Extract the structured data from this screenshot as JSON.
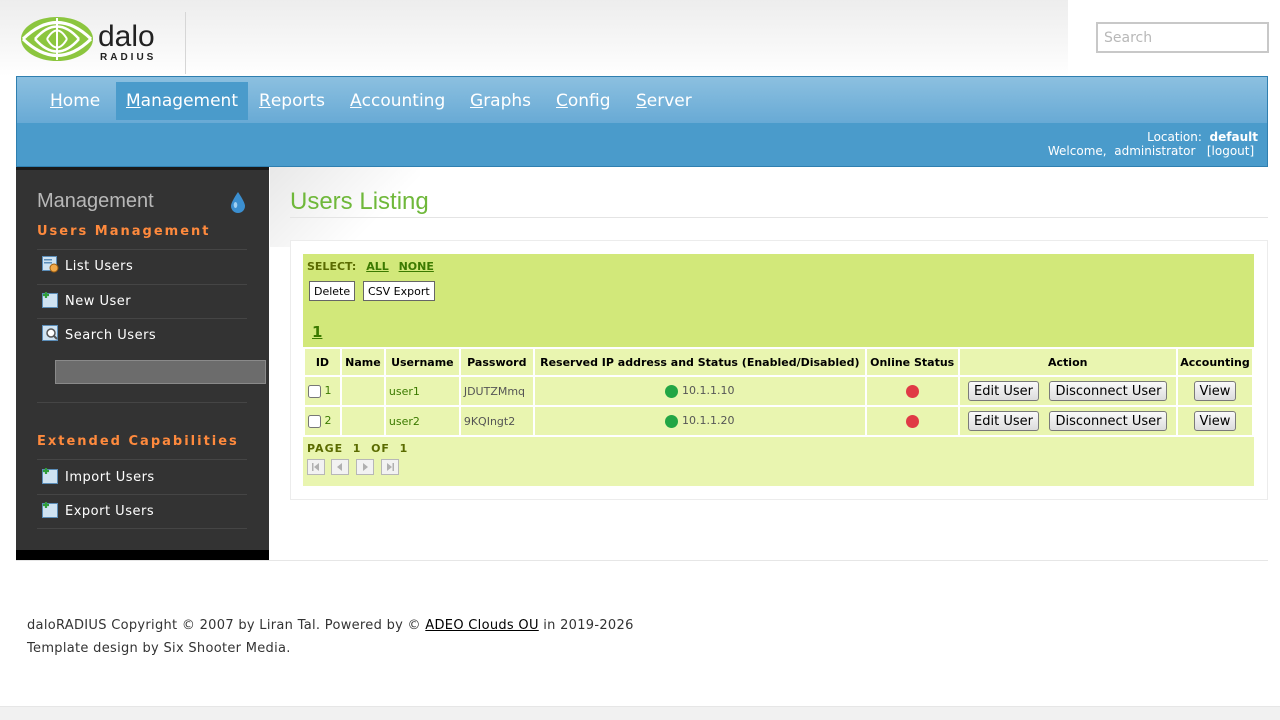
{
  "header": {
    "logo_top": "dalo",
    "logo_bottom": "RADIUS",
    "search_placeholder": "Search"
  },
  "nav": {
    "items": [
      {
        "first": "H",
        "rest": "ome"
      },
      {
        "first": "M",
        "rest": "anagement"
      },
      {
        "first": "R",
        "rest": "eports"
      },
      {
        "first": "A",
        "rest": "ccounting"
      },
      {
        "first": "G",
        "rest": "raphs"
      },
      {
        "first": "C",
        "rest": "onfig"
      },
      {
        "first": "S",
        "rest": "erver"
      }
    ],
    "active": "Management",
    "location_label": "Location:",
    "location_value": "default",
    "welcome": "Welcome,",
    "user": "administrator",
    "logout": "[logout]"
  },
  "sidebar": {
    "title": "Management",
    "section1": "Users Management",
    "items1": [
      "List Users",
      "New User",
      "Search Users"
    ],
    "section2": "Extended Capabilities",
    "items2": [
      "Import Users",
      "Export Users"
    ]
  },
  "main": {
    "title": "Users Listing",
    "select_label": "SELECT:",
    "select_all": "ALL",
    "select_none": "NONE",
    "delete_btn": "Delete",
    "csv_btn": "CSV Export",
    "page_link": "1",
    "columns": [
      "ID",
      "Name",
      "Username",
      "Password",
      "Reserved IP address and Status (Enabled/Disabled)",
      "Online Status",
      "Action",
      "Accounting"
    ],
    "rows": [
      {
        "id": "1",
        "name": "",
        "username": "user1",
        "password": "JDUTZMmq",
        "ip": "10.1.1.10",
        "edit": "Edit User",
        "disconnect": "Disconnect User",
        "view": "View"
      },
      {
        "id": "2",
        "name": "",
        "username": "user2",
        "password": "9KQIngt2",
        "ip": "10.1.1.20",
        "edit": "Edit User",
        "disconnect": "Disconnect User",
        "view": "View"
      }
    ],
    "pager": "PAGE  1  OF  1"
  },
  "footer": {
    "line1_pre": "daloRADIUS Copyright © 2007 by Liran Tal. Powered by ©",
    "line1_link": "ADEO Clouds OU",
    "line1_post": "in 2019-2026",
    "line2": "Template design by Six Shooter Media."
  },
  "colors": {
    "accent_green": "#6fb83a",
    "nav_blue": "#4a9bcb",
    "section_orange": "#ff8a3d",
    "status_enabled": "#22a645",
    "status_offline": "#e03a45"
  }
}
